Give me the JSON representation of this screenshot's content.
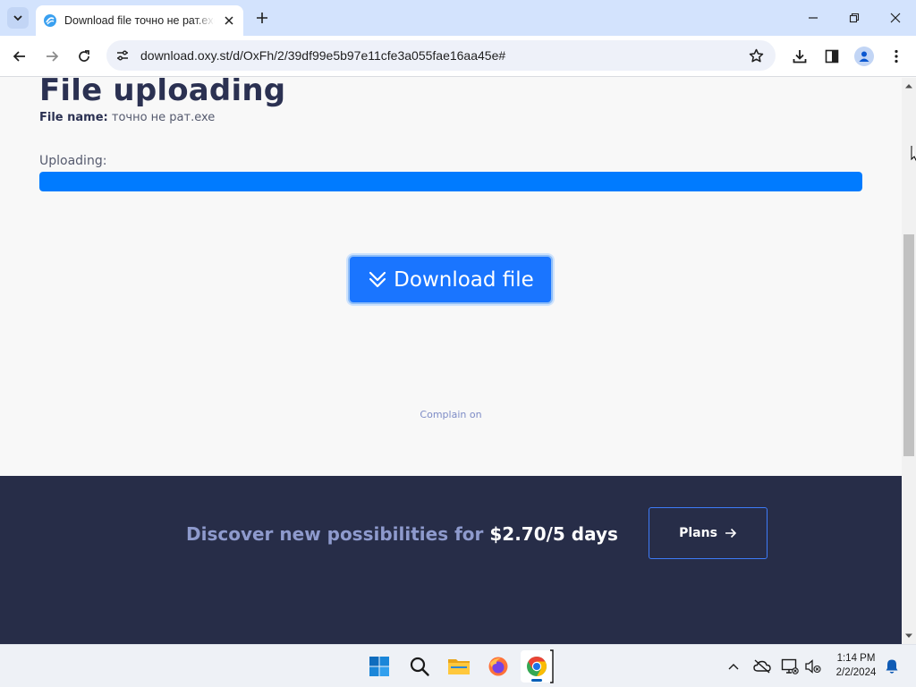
{
  "browser": {
    "tab_title": "Download file точно не рат.exe",
    "url": "download.oxy.st/d/OxFh/2/39df99e5b97e11cfe3a055fae16aa45e#"
  },
  "page": {
    "title": "File uploading",
    "file_name_label": "File name:",
    "file_name_value": "точно не рат.exe",
    "uploading_label": "Uploading:",
    "upload_progress_percent": 100,
    "download_button_label": "Download file",
    "complain_link": "Complain on"
  },
  "promo": {
    "text": "Discover new possibilities for",
    "price": "$2.70/5 days",
    "plans_button_label": "Plans"
  },
  "taskbar": {
    "time": "1:14 PM",
    "date": "2/2/2024",
    "apps": [
      "start-icon",
      "search-icon",
      "file-explorer-icon",
      "firefox-icon",
      "chrome-icon"
    ]
  },
  "colors": {
    "accent": "#007bff",
    "title": "#2b3152",
    "promo_bg": "#272d48"
  }
}
